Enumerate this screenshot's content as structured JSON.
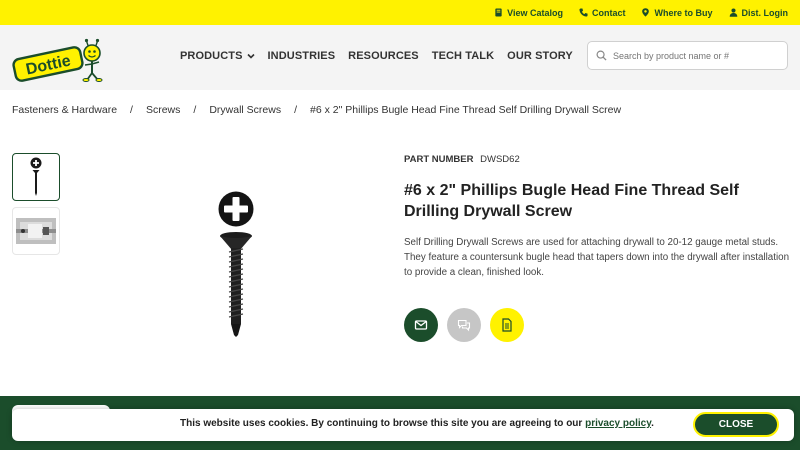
{
  "topbar": {
    "links": [
      {
        "label": "View Catalog",
        "icon": "catalog-icon"
      },
      {
        "label": "Contact",
        "icon": "phone-icon"
      },
      {
        "label": "Where to Buy",
        "icon": "map-pin-icon"
      },
      {
        "label": "Dist. Login",
        "icon": "user-icon"
      }
    ]
  },
  "header": {
    "logo_text": "Dottie",
    "nav": [
      {
        "label": "PRODUCTS",
        "has_dropdown": true
      },
      {
        "label": "INDUSTRIES"
      },
      {
        "label": "RESOURCES"
      },
      {
        "label": "TECH TALK"
      },
      {
        "label": "OUR STORY"
      }
    ],
    "search_placeholder": "Search by product name or #"
  },
  "breadcrumb": [
    "Fasteners & Hardware",
    "Screws",
    "Drywall Screws",
    "#6 x 2\" Phillips Bugle Head Fine Thread Self Drilling Drywall Screw"
  ],
  "breadcrumb_separator": "/",
  "product": {
    "part_number_label": "PART NUMBER",
    "part_number": "DWSD62",
    "title": "#6 x 2\" Phillips Bugle Head Fine Thread Self Drilling Drywall Screw",
    "description": "Self Drilling Drywall Screws are used for attaching drywall to 20-12 gauge metal studs. They feature a countersunk bugle head that tapers down into the drywall after installation to provide a clean, finished look."
  },
  "actions": [
    {
      "icon": "email-icon"
    },
    {
      "icon": "chat-icon"
    },
    {
      "icon": "document-icon"
    }
  ],
  "cookie": {
    "text": "This website uses cookies. By continuing to browse this site you are agreeing to our ",
    "link_text": "privacy policy",
    "suffix": ".",
    "close_label": "CLOSE"
  },
  "colors": {
    "brand_yellow": "#fff200",
    "brand_green": "#1b4d2b"
  }
}
